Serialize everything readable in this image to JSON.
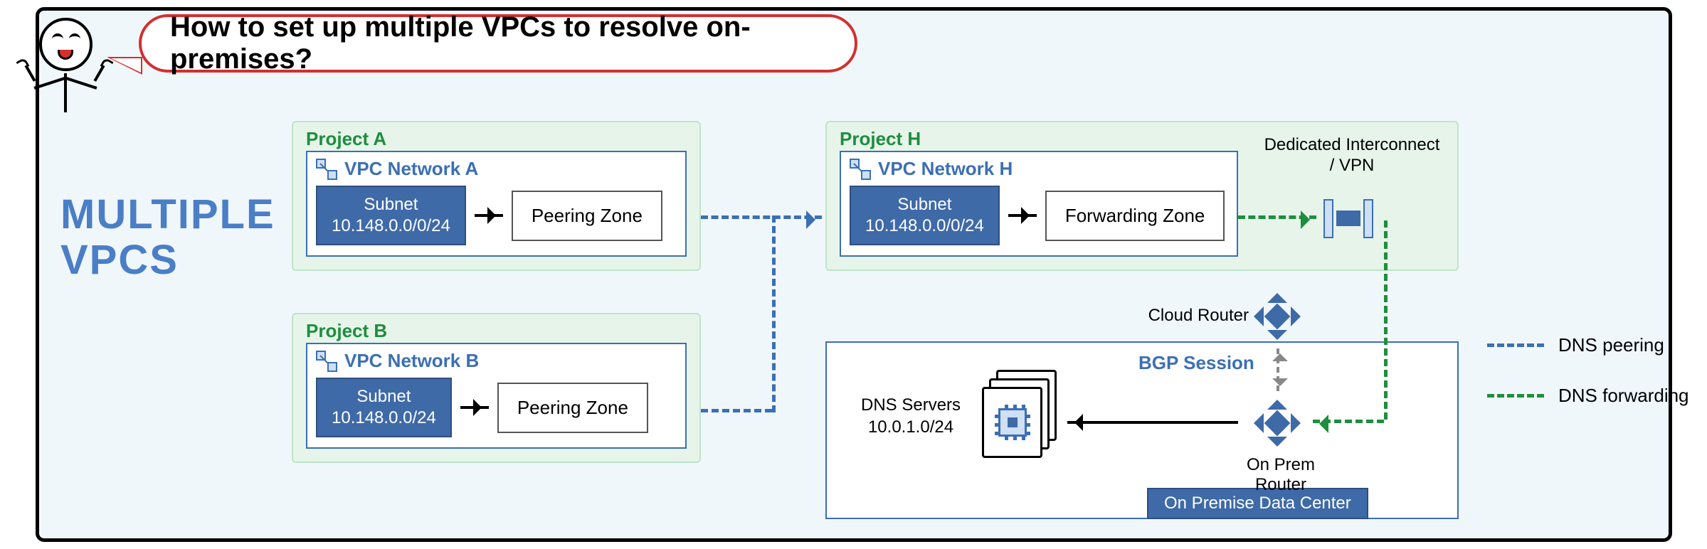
{
  "title_text": "How to set up multiple VPCs to resolve on-premises?",
  "big_title_line1": "MULTIPLE",
  "big_title_line2": "VPCS",
  "project_a": {
    "label": "Project A",
    "vpc_name": "VPC Network A",
    "subnet_label": "Subnet",
    "subnet_cidr": "10.148.0.0/0/24",
    "zone": "Peering Zone"
  },
  "project_b": {
    "label": "Project B",
    "vpc_name": "VPC Network B",
    "subnet_label": "Subnet",
    "subnet_cidr": "10.148.0.0/24",
    "zone": "Peering Zone"
  },
  "project_h": {
    "label": "Project H",
    "vpc_name": "VPC Network H",
    "subnet_label": "Subnet",
    "subnet_cidr": "10.148.0.0/0/24",
    "zone": "Forwarding Zone"
  },
  "interconnect_label": "Dedicated Interconnect / VPN",
  "cloud_router_label": "Cloud Router",
  "onprem_router_label": "On Prem Router",
  "bgp_label": "BGP Session",
  "dns_servers_label": "DNS Servers",
  "dns_servers_cidr": "10.0.1.0/24",
  "onprem_title": "On Premise Data Center",
  "legend": {
    "peering": "DNS peering",
    "forwarding": "DNS forwarding"
  }
}
